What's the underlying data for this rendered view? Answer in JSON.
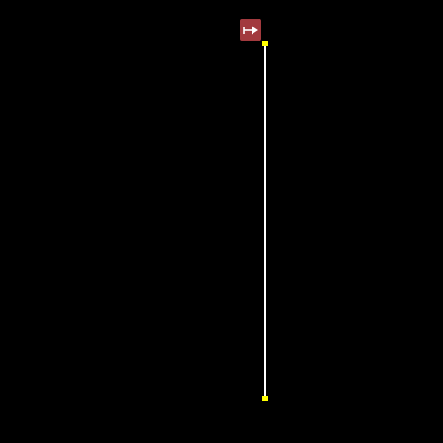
{
  "colors": {
    "background": "#000000",
    "y_axis": "#8b1a1a",
    "x_axis": "#1e8f2a",
    "segment": "#ffffff",
    "handle": "#ffff00",
    "tool_button_bg": "#a23a3e",
    "tool_icon": "#ffffff"
  },
  "icons": {
    "tool_button": "arrow-right-from-bar-icon",
    "handle": "endpoint-handle"
  }
}
